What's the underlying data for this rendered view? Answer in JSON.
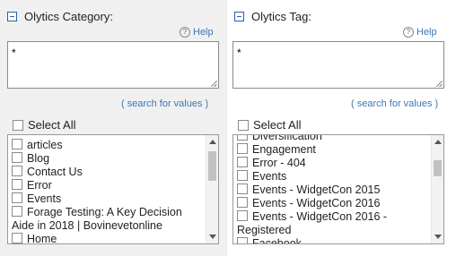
{
  "category": {
    "title": "Olytics Category:",
    "help_label": "Help",
    "textarea_value": "*",
    "search_link": "( search for values )",
    "select_all_label": "Select All",
    "items": [
      "articles",
      "Blog",
      "Contact Us",
      "Error",
      "Events",
      "Forage Testing: A Key Decision Aide in 2018 | Bovinevetonline",
      "Home"
    ],
    "scroll_position": 0.1
  },
  "tag": {
    "title": "Olytics Tag:",
    "help_label": "Help",
    "textarea_value": "*",
    "search_link": "( search for values )",
    "select_all_label": "Select All",
    "items": [
      "Diversification",
      "Engagement",
      "Error - 404",
      "Events",
      "Events - WidgetCon 2015",
      "Events - WidgetCon 2016",
      "Events - WidgetCon 2016 - Registered",
      "Facebook"
    ],
    "scroll_position": 0.15
  },
  "colors": {
    "link": "#3a78b5",
    "collapse": "#2d5ca8",
    "left_bg": "#f0f0f0"
  },
  "icons": {
    "collapse": "minus-box-icon",
    "help": "question-circle-icon"
  }
}
